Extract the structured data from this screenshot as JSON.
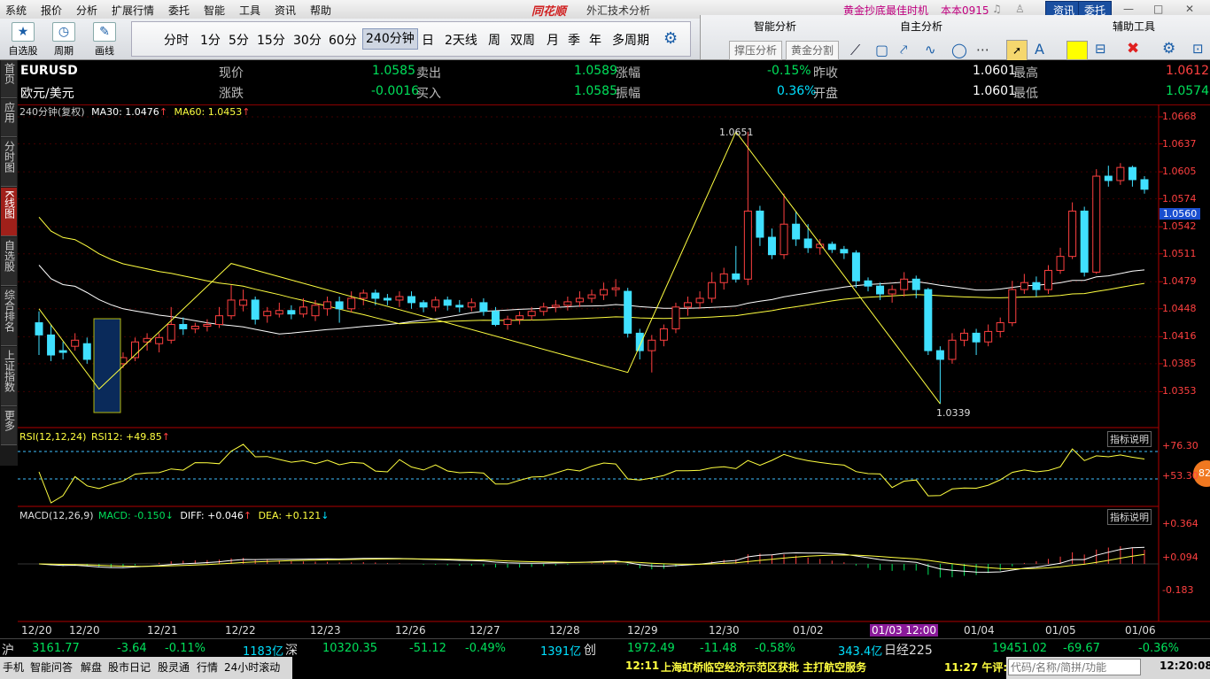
{
  "menubar": {
    "items": [
      "系统",
      "报价",
      "分析",
      "扩展行情",
      "委托",
      "智能",
      "工具",
      "资讯",
      "帮助"
    ],
    "brand": "同花顺",
    "app_title": "外汇技术分析",
    "promo": "黄金抄底最佳时机",
    "version": "本本0915",
    "btn_news": "资讯",
    "btn_trade": "委托"
  },
  "toolbar": {
    "self_select": "自选股",
    "period": "周期",
    "draw": "画线",
    "periods": [
      "分时",
      "1分",
      "5分",
      "15分",
      "30分",
      "60分",
      "240分钟",
      "日",
      "2天线",
      "周",
      "双周",
      "月",
      "季",
      "年",
      "多周期"
    ],
    "active_period": "240分钟",
    "panel_smart": "智能分析",
    "panel_custom": "自主分析",
    "panel_aux": "辅助工具",
    "btn_sr": "撑压分析",
    "btn_golden": "黄金分割"
  },
  "left_tabs": [
    "首页",
    "应用",
    "分时图",
    "K线图",
    "自选股",
    "综合排名",
    "上证指数",
    "更多"
  ],
  "quote": {
    "symbol": "EURUSD",
    "name": "欧元/美元",
    "row1": [
      {
        "label": "现价",
        "value": "1.0585"
      },
      {
        "label": "卖出",
        "value": "1.0589"
      },
      {
        "label": "涨幅",
        "value": "-0.15%"
      },
      {
        "label": "昨收",
        "value": "1.0601"
      },
      {
        "label": "最高",
        "value": "1.0612"
      }
    ],
    "row2": [
      {
        "label": "涨跌",
        "value": "-0.0016"
      },
      {
        "label": "买入",
        "value": "1.0585"
      },
      {
        "label": "振幅",
        "value": "0.36%"
      },
      {
        "label": "开盘",
        "value": "1.0601"
      },
      {
        "label": "最低",
        "value": "1.0574"
      }
    ]
  },
  "indicators": {
    "main_label": "240分钟(复权)",
    "ma30_label": "MA30: 1.0476",
    "ma60_label": "MA60: 1.0453",
    "rsi_label": "RSI(12,12,24)",
    "rsi12_label": "RSI12: +49.85",
    "macd_label": "MACD(12,26,9)",
    "macd_val": "MACD: -0.150",
    "diff_val": "DIFF: +0.046",
    "dea_val": "DEA: +0.121",
    "explain": "指标说明",
    "rsi_circle": "82"
  },
  "chart_data": {
    "type": "candlestick",
    "y_ticks": [
      "1.0668",
      "1.0637",
      "1.0605",
      "1.0574",
      "1.0542",
      "1.0511",
      "1.0479",
      "1.0448",
      "1.0416",
      "1.0385",
      "1.0353"
    ],
    "ylim": [
      1.0325,
      1.0668
    ],
    "current_price_label": "1.0560",
    "high_annotation": "1.0651",
    "low_annotation": "1.0339",
    "x_labels": [
      "12/20",
      "12/20",
      "12/21",
      "12/22",
      "12/23",
      "12/26",
      "12/27",
      "12/28",
      "12/29",
      "12/30",
      "01/02",
      "01/03 12:00",
      "01/04",
      "01/05",
      "01/06"
    ],
    "candles": [
      [
        1.0432,
        1.0418,
        1.0445,
        1.0395
      ],
      [
        1.0418,
        1.0395,
        1.043,
        1.0388
      ],
      [
        1.04,
        1.0398,
        1.041,
        1.039
      ],
      [
        1.0405,
        1.0412,
        1.042,
        1.04
      ],
      [
        1.0408,
        1.039,
        1.0415,
        1.0385
      ],
      [
        1.039,
        1.0378,
        1.0395,
        1.0365
      ],
      [
        1.0378,
        1.0385,
        1.039,
        1.0365
      ],
      [
        1.0385,
        1.0392,
        1.0398,
        1.038
      ],
      [
        1.0392,
        1.041,
        1.0415,
        1.0388
      ],
      [
        1.041,
        1.0414,
        1.042,
        1.04
      ],
      [
        1.0408,
        1.0415,
        1.042,
        1.0398
      ],
      [
        1.0412,
        1.043,
        1.045,
        1.0408
      ],
      [
        1.043,
        1.0425,
        1.0438,
        1.0418
      ],
      [
        1.0425,
        1.0428,
        1.0432,
        1.042
      ],
      [
        1.0428,
        1.043,
        1.0436,
        1.0422
      ],
      [
        1.043,
        1.044,
        1.045,
        1.0426
      ],
      [
        1.044,
        1.0458,
        1.0475,
        1.0436
      ],
      [
        1.0452,
        1.0458,
        1.047,
        1.0445
      ],
      [
        1.0458,
        1.0436,
        1.0462,
        1.043
      ],
      [
        1.044,
        1.0445,
        1.045,
        1.0432
      ],
      [
        1.0442,
        1.0446,
        1.0455,
        1.0438
      ],
      [
        1.0446,
        1.0442,
        1.0452,
        1.0436
      ],
      [
        1.0442,
        1.045,
        1.046,
        1.0438
      ],
      [
        1.044,
        1.0452,
        1.0458,
        1.0434
      ],
      [
        1.0448,
        1.0456,
        1.0462,
        1.044
      ],
      [
        1.0456,
        1.0448,
        1.0462,
        1.0432
      ],
      [
        1.0448,
        1.046,
        1.0468,
        1.0444
      ],
      [
        1.046,
        1.0466,
        1.047,
        1.0452
      ],
      [
        1.0466,
        1.046,
        1.047,
        1.0452
      ],
      [
        1.046,
        1.0458,
        1.0465,
        1.0452
      ],
      [
        1.0458,
        1.0462,
        1.0468,
        1.045
      ],
      [
        1.0462,
        1.0455,
        1.0468,
        1.0448
      ],
      [
        1.0455,
        1.045,
        1.0458,
        1.0444
      ],
      [
        1.045,
        1.0458,
        1.0462,
        1.0445
      ],
      [
        1.0458,
        1.0452,
        1.0462,
        1.0446
      ],
      [
        1.0452,
        1.045,
        1.0458,
        1.0444
      ],
      [
        1.045,
        1.0455,
        1.046,
        1.0445
      ],
      [
        1.0455,
        1.0445,
        1.046,
        1.044
      ],
      [
        1.0445,
        1.043,
        1.045,
        1.0428
      ],
      [
        1.043,
        1.0436,
        1.044,
        1.0424
      ],
      [
        1.0436,
        1.044,
        1.0445,
        1.043
      ],
      [
        1.044,
        1.0445,
        1.045,
        1.0435
      ],
      [
        1.0445,
        1.045,
        1.0455,
        1.044
      ],
      [
        1.045,
        1.0452,
        1.0458,
        1.0444
      ],
      [
        1.0452,
        1.0456,
        1.0462,
        1.0446
      ],
      [
        1.0456,
        1.046,
        1.0468,
        1.045
      ],
      [
        1.046,
        1.0464,
        1.047,
        1.0455
      ],
      [
        1.0464,
        1.047,
        1.0478,
        1.0458
      ],
      [
        1.047,
        1.0472,
        1.0482,
        1.0462
      ],
      [
        1.0468,
        1.042,
        1.0472,
        1.0415
      ],
      [
        1.042,
        1.04,
        1.0425,
        1.039
      ],
      [
        1.04,
        1.0412,
        1.0418,
        1.0375
      ],
      [
        1.0412,
        1.0425,
        1.043,
        1.0405
      ],
      [
        1.0425,
        1.045,
        1.0455,
        1.042
      ],
      [
        1.045,
        1.0455,
        1.0462,
        1.044
      ],
      [
        1.0455,
        1.046,
        1.0468,
        1.0448
      ],
      [
        1.046,
        1.0478,
        1.049,
        1.0455
      ],
      [
        1.0478,
        1.0488,
        1.0495,
        1.047
      ],
      [
        1.0488,
        1.0482,
        1.052,
        1.0478
      ],
      [
        1.0482,
        1.056,
        1.0651,
        1.0475
      ],
      [
        1.056,
        1.053,
        1.0566,
        1.052
      ],
      [
        1.053,
        1.051,
        1.054,
        1.0505
      ],
      [
        1.051,
        1.0545,
        1.058,
        1.0505
      ],
      [
        1.0545,
        1.0528,
        1.056,
        1.052
      ],
      [
        1.0528,
        1.0518,
        1.0545,
        1.0512
      ],
      [
        1.0518,
        1.0522,
        1.0528,
        1.051
      ],
      [
        1.0522,
        1.0516,
        1.0525,
        1.0512
      ],
      [
        1.0516,
        1.0512,
        1.052,
        1.0505
      ],
      [
        1.0512,
        1.048,
        1.0515,
        1.0472
      ],
      [
        1.048,
        1.0474,
        1.0484,
        1.0468
      ],
      [
        1.0474,
        1.0465,
        1.0478,
        1.0458
      ],
      [
        1.0465,
        1.047,
        1.0475,
        1.0455
      ],
      [
        1.047,
        1.0482,
        1.049,
        1.0462
      ],
      [
        1.0482,
        1.047,
        1.0486,
        1.046
      ],
      [
        1.047,
        1.04,
        1.0472,
        1.0395
      ],
      [
        1.04,
        1.039,
        1.0405,
        1.0339
      ],
      [
        1.039,
        1.0412,
        1.042,
        1.0385
      ],
      [
        1.0412,
        1.042,
        1.0425,
        1.0405
      ],
      [
        1.042,
        1.041,
        1.0425,
        1.0395
      ],
      [
        1.041,
        1.0422,
        1.043,
        1.0405
      ],
      [
        1.0422,
        1.0432,
        1.0438,
        1.0415
      ],
      [
        1.0432,
        1.047,
        1.048,
        1.0428
      ],
      [
        1.047,
        1.0478,
        1.0488,
        1.0465
      ],
      [
        1.0478,
        1.047,
        1.0485,
        1.0462
      ],
      [
        1.047,
        1.0492,
        1.0498,
        1.0465
      ],
      [
        1.0492,
        1.0508,
        1.0518,
        1.0488
      ],
      [
        1.0508,
        1.056,
        1.057,
        1.0505
      ],
      [
        1.056,
        1.049,
        1.0565,
        1.0485
      ],
      [
        1.049,
        1.06,
        1.0608,
        1.0488
      ],
      [
        1.06,
        1.0595,
        1.0612,
        1.0588
      ],
      [
        1.0595,
        1.061,
        1.0615,
        1.059
      ],
      [
        1.061,
        1.0596,
        1.0612,
        1.0588
      ],
      [
        1.0596,
        1.0585,
        1.06,
        1.058
      ]
    ]
  },
  "ticker": {
    "sh_label": "沪",
    "sh_val": "3161.77",
    "sh_chg": "-3.64",
    "sh_pct": "-0.11%",
    "sh_amt": "1183亿",
    "sz_label": "深",
    "sz_val": "10320.35",
    "sz_chg": "-51.12",
    "sz_pct": "-0.49%",
    "sz_amt": "1391亿",
    "cy_label": "创",
    "cy_val": "1972.49",
    "cy_chg": "-11.48",
    "cy_pct": "-0.58%",
    "cy_amt": "343.4亿",
    "nk_label": "日经225",
    "nk_val": "19451.02",
    "nk_chg": "-69.67",
    "nk_pct": "-0.36%"
  },
  "statusbar": {
    "items": [
      "手机",
      "智能问答",
      "解盘",
      "股市日记",
      "股灵通",
      "行情",
      "24小时滚动"
    ],
    "news_time": "12:11",
    "news": "上海虹桥临空经济示范区获批 主打航空服务",
    "comment_time": "11:27 午评:",
    "search_placeholder": "代码/名称/简拼/功能",
    "clock": "12:20:08"
  }
}
